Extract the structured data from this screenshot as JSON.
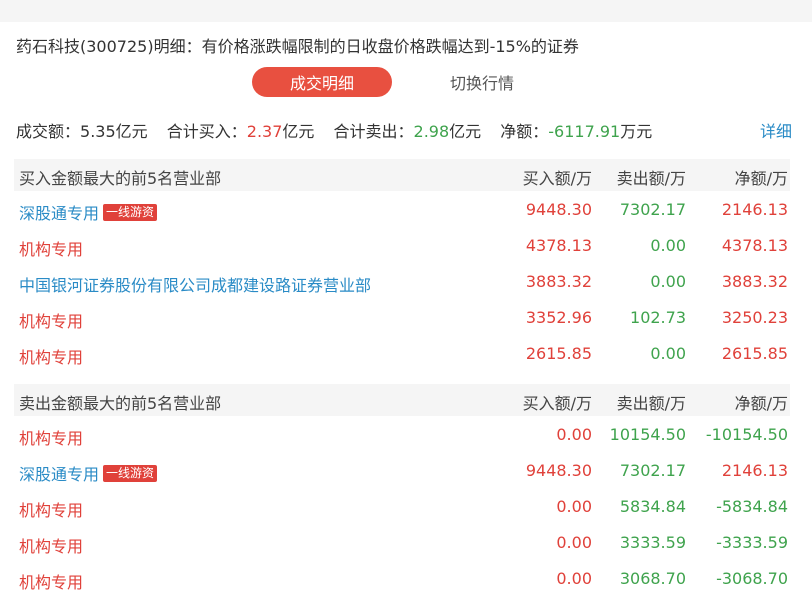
{
  "title": "药石科技(300725)明细：有价格涨跌幅限制的日收盘价格跌幅达到-15%的证券",
  "tabs": {
    "active": "成交明细",
    "other": "切换行情"
  },
  "summary": {
    "turnover_label": "成交额：",
    "turnover_value": "5.35亿元",
    "buy_label": "合计买入：",
    "buy_value": "2.37",
    "buy_unit": "亿元",
    "sell_label": "合计卖出：",
    "sell_value": "2.98",
    "sell_unit": "亿元",
    "net_label": "净额：",
    "net_value": "-6117.91",
    "net_unit": "万元"
  },
  "detail_link": "详细",
  "buy_section": {
    "title": "买入金额最大的前5名营业部",
    "columns": [
      "买入额/万",
      "卖出额/万",
      "净额/万"
    ],
    "rows": [
      {
        "name": "深股通专用",
        "badge": "一线游资",
        "buy": "9448.30",
        "sell": "7302.17",
        "net": "2146.13"
      },
      {
        "name": "机构专用",
        "badge": "",
        "buy": "4378.13",
        "sell": "0.00",
        "net": "4378.13"
      },
      {
        "name": "中国银河证券股份有限公司成都建设路证券营业部",
        "badge": "",
        "buy": "3883.32",
        "sell": "0.00",
        "net": "3883.32"
      },
      {
        "name": "机构专用",
        "badge": "",
        "buy": "3352.96",
        "sell": "102.73",
        "net": "3250.23"
      },
      {
        "name": "机构专用",
        "badge": "",
        "buy": "2615.85",
        "sell": "0.00",
        "net": "2615.85"
      }
    ]
  },
  "sell_section": {
    "title": "卖出金额最大的前5名营业部",
    "columns": [
      "买入额/万",
      "卖出额/万",
      "净额/万"
    ],
    "rows": [
      {
        "name": "机构专用",
        "badge": "",
        "buy": "0.00",
        "sell": "10154.50",
        "net": "-10154.50"
      },
      {
        "name": "深股通专用",
        "badge": "一线游资",
        "buy": "9448.30",
        "sell": "7302.17",
        "net": "2146.13"
      },
      {
        "name": "机构专用",
        "badge": "",
        "buy": "0.00",
        "sell": "5834.84",
        "net": "-5834.84"
      },
      {
        "name": "机构专用",
        "badge": "",
        "buy": "0.00",
        "sell": "3333.59",
        "net": "-3333.59"
      },
      {
        "name": "机构专用",
        "badge": "",
        "buy": "0.00",
        "sell": "3068.70",
        "net": "-3068.70"
      }
    ]
  },
  "colors": {
    "red": "#e0413a",
    "green": "#3fa34d",
    "link": "#2a8bc6",
    "tab_active": "#e85040"
  }
}
